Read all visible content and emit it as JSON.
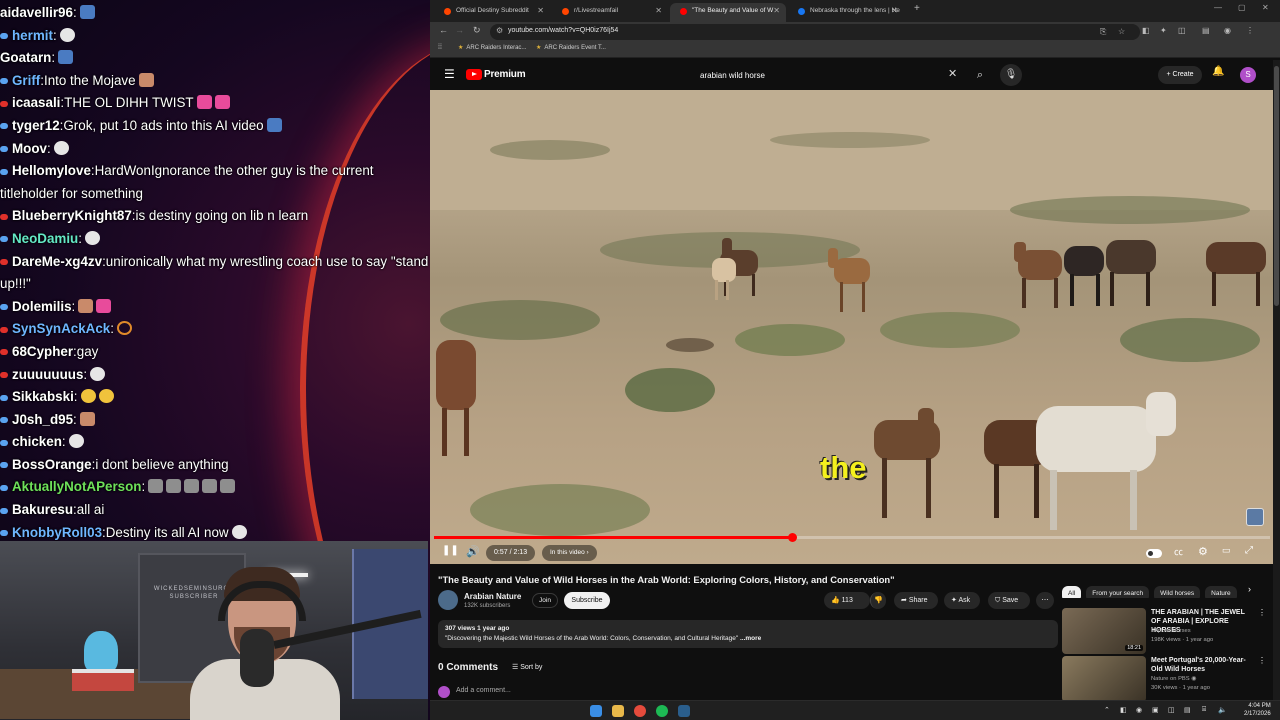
{
  "chat": [
    {
      "user": "aidavellir96",
      "sep": ":",
      "text": "",
      "color": "#ffffff",
      "dot": "",
      "emotes": [
        "blue"
      ]
    },
    {
      "user": "hermit",
      "sep": ":",
      "text": "",
      "color": "#6fb6ff",
      "dot": "#5aa3f0",
      "emotes": [
        "white"
      ]
    },
    {
      "user": "Goatarn",
      "sep": ":",
      "text": "",
      "color": "#ffffff",
      "dot": "",
      "emotes": [
        "blue"
      ]
    },
    {
      "user": "Griff",
      "sep": ":",
      "text": "Into the Mojave",
      "color": "#6fb6ff",
      "dot": "#5aa3f0",
      "emotes": [
        "skin"
      ]
    },
    {
      "user": "icaasali",
      "sep": ":",
      "text": "THE OL DIHH TWIST",
      "color": "#ffffff",
      "dot": "#e0302a",
      "emotes": [
        "pink",
        "pink"
      ]
    },
    {
      "user": "tyger12",
      "sep": ":",
      "text": "Grok, put 10 ads into this AI video",
      "color": "#ffffff",
      "dot": "#5aa3f0",
      "emotes": [
        "blue"
      ]
    },
    {
      "user": "Moov",
      "sep": ":",
      "text": "",
      "color": "#ffffff",
      "dot": "#5aa3f0",
      "emotes": [
        "white"
      ]
    },
    {
      "user": "Hellomylove",
      "sep": ":",
      "text": "HardWonIgnorance the other guy is the current titleholder for something",
      "color": "#ffffff",
      "dot": "#5aa3f0",
      "emotes": [],
      "wrap": true
    },
    {
      "user": "BlueberryKnight87",
      "sep": ":",
      "text": "is destiny going on lib n learn",
      "color": "#ffffff",
      "dot": "#e0302a",
      "emotes": []
    },
    {
      "user": "NeoDamiu",
      "sep": ":",
      "text": "",
      "color": "#64e8c6",
      "dot": "#5aa3f0",
      "emotes": [
        "white"
      ]
    },
    {
      "user": "DareMe-xg4zv",
      "sep": ":",
      "text": "unironically what my wrestling coach use to say \"stand up!!!\"",
      "color": "#ffffff",
      "dot": "#e0302a",
      "emotes": [],
      "wrap": true
    },
    {
      "user": "Dolemilis",
      "sep": ":",
      "text": "",
      "color": "#ffffff",
      "dot": "#5aa3f0",
      "emotes": [
        "skin",
        "pink"
      ]
    },
    {
      "user": "SynSynAckAck",
      "sep": ":",
      "text": "",
      "color": "#6fb6ff",
      "dot": "#e0302a",
      "emotes": [
        "ring"
      ]
    },
    {
      "user": "68Cypher",
      "sep": ":",
      "text": "gay",
      "color": "#ffffff",
      "dot": "#e0302a",
      "emotes": []
    },
    {
      "user": "zuuuuuuus",
      "sep": ":",
      "text": "",
      "color": "#ffffff",
      "dot": "#e0302a",
      "emotes": [
        "white"
      ]
    },
    {
      "user": "Sikkabski",
      "sep": ":",
      "text": "",
      "color": "#ffffff",
      "dot": "#5aa3f0",
      "emotes": [
        "yellow",
        "yellow"
      ]
    },
    {
      "user": "J0sh_d95",
      "sep": ":",
      "text": "",
      "color": "#ffffff",
      "dot": "#5aa3f0",
      "emotes": [
        "skin"
      ]
    },
    {
      "user": "chicken",
      "sep": ":",
      "text": "",
      "color": "#ffffff",
      "dot": "#5aa3f0",
      "emotes": [
        "white"
      ]
    },
    {
      "user": "BossOrange",
      "sep": ":",
      "text": "i dont believe anything",
      "color": "#ffffff",
      "dot": "#5aa3f0",
      "emotes": []
    },
    {
      "user": "AktuallyNotAPerson",
      "sep": ":",
      "text": "",
      "color": "#6ee05a",
      "dot": "#5aa3f0",
      "emotes": [
        "",
        "",
        "",
        "",
        ""
      ]
    },
    {
      "user": "Bakuresu",
      "sep": ":",
      "text": "all ai",
      "color": "#ffffff",
      "dot": "#5aa3f0",
      "emotes": []
    },
    {
      "user": "KnobbyRoll03",
      "sep": ":",
      "text": "Destiny its all AI now",
      "color": "#6fb6ff",
      "dot": "#5aa3f0",
      "emotes": [
        "white"
      ]
    }
  ],
  "webcam": {
    "monitor_text": "WICKEDSEMINSURGE SUBSCRIBER"
  },
  "browser": {
    "tabs": [
      {
        "title": "Official Destiny Subreddit",
        "color": "#ff4500",
        "active": false
      },
      {
        "title": "r/Livestreamfail",
        "color": "#ff4500",
        "active": false
      },
      {
        "title": "\"The Beauty and Value of W",
        "color": "#ff0000",
        "active": true
      },
      {
        "title": "Nebraska through the lens | He",
        "color": "#1877f2",
        "active": false
      }
    ],
    "new_tab": "+",
    "url": "youtube.com/watch?v=QH0iz76Ij54",
    "bookmarks": [
      "ARC Raiders Interac...",
      "ARC Raiders Event T..."
    ]
  },
  "youtube": {
    "brand": "Premium",
    "search_value": "arabian wild horse",
    "create_label": "Create",
    "avatar_letter": "S",
    "caption_word": "the",
    "progress_fraction": 0.428,
    "time_display": "0:57 / 2:13",
    "chapter_label": "In this video ›",
    "video_title": "\"The Beauty and Value of Wild Horses in the Arab World: Exploring Colors, History, and Conservation\"",
    "channel_name": "Arabian Nature",
    "channel_subs": "132K subscribers",
    "join_label": "Join",
    "subscribe_label": "Subscribe",
    "like_count": "113",
    "share_label": "Share",
    "ask_label": "Ask",
    "save_label": "Save",
    "desc_meta": "307 views  1 year ago",
    "desc_text": "\"Discovering the Majestic Wild Horses of the Arab World: Colors, Conservation, and Cultural Heritage\"",
    "desc_more": " ...more",
    "comments_count": "0 Comments",
    "sort_label": "Sort by",
    "add_comment": "Add a comment...",
    "chips": [
      {
        "label": "All",
        "active": true
      },
      {
        "label": "From your search",
        "active": false
      },
      {
        "label": "Wild horses",
        "active": false
      },
      {
        "label": "Nature",
        "active": false
      }
    ],
    "recommendations": [
      {
        "title": "THE ARABIAN | THE JEWEL OF ARABIA | EXPLORE HORSES",
        "channel": "Explore Horses",
        "meta": "198K views · 1 year ago",
        "duration": "18:21",
        "thumb_color": "#7a6a55"
      },
      {
        "title": "Meet Portugal's 20,000-Year-Old Wild Horses",
        "channel": "Nature on PBS ◉",
        "meta": "30K views · 1 year ago",
        "duration": "",
        "thumb_color": "#8a7a5e"
      }
    ]
  },
  "taskbar": {
    "time": "4:04 PM",
    "date": "2/17/2026"
  }
}
